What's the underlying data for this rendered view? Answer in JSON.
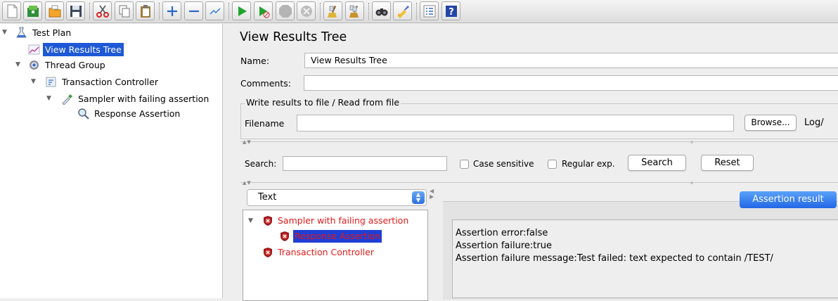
{
  "left_tree": {
    "nodes": [
      {
        "label": "Test Plan",
        "icon": "test-plan-icon"
      },
      {
        "label": "View Results Tree",
        "icon": "chart-icon"
      },
      {
        "label": "Thread Group",
        "icon": "gear-icon"
      },
      {
        "label": "Transaction Controller",
        "icon": "controller-icon"
      },
      {
        "label": "Sampler with failing assertion",
        "icon": "pipette-icon"
      },
      {
        "label": "Response Assertion",
        "icon": "magnifier-icon"
      }
    ],
    "selected": "View Results Tree"
  },
  "panel": {
    "title": "View Results Tree",
    "name_label": "Name:",
    "name_value": "View Results Tree",
    "comments_label": "Comments:",
    "comments_value": "",
    "file_group_legend": "Write results to file / Read from file",
    "filename_label": "Filename",
    "filename_value": "",
    "browse_label": "Browse...",
    "log_label": "Log/"
  },
  "search": {
    "label": "Search:",
    "value": "",
    "case_sensitive_label": "Case sensitive",
    "regex_label": "Regular exp.",
    "search_button": "Search",
    "reset_button": "Reset"
  },
  "renderer": {
    "selected": "Text"
  },
  "results_tree": {
    "nodes": [
      {
        "label": "Sampler with failing assertion",
        "status": "failed"
      },
      {
        "label": "Response Assertion",
        "status": "failed"
      },
      {
        "label": "Transaction Controller",
        "status": "failed"
      }
    ],
    "selected": "Response Assertion"
  },
  "result_panel": {
    "tab_label": "Assertion result",
    "lines": [
      "Assertion error:false",
      "Assertion failure:true",
      "Assertion failure message:Test failed: text expected to contain /TEST/"
    ]
  },
  "colors": {
    "selection": "#1d58d6",
    "failed_text": "#e31a1a",
    "tab_accent": "#2266e6"
  },
  "toolbar_icons": [
    "new-icon",
    "templates-icon",
    "open-icon",
    "save-icon",
    "cut-icon",
    "copy-icon",
    "paste-icon",
    "expand-icon",
    "collapse-icon",
    "toggle-icon",
    "start-icon",
    "start-no-pauses-icon",
    "stop-icon",
    "shutdown-icon",
    "clear-icon",
    "clear-all-icon",
    "search-icon",
    "reset-search-icon",
    "function-helper-icon",
    "help-icon"
  ]
}
